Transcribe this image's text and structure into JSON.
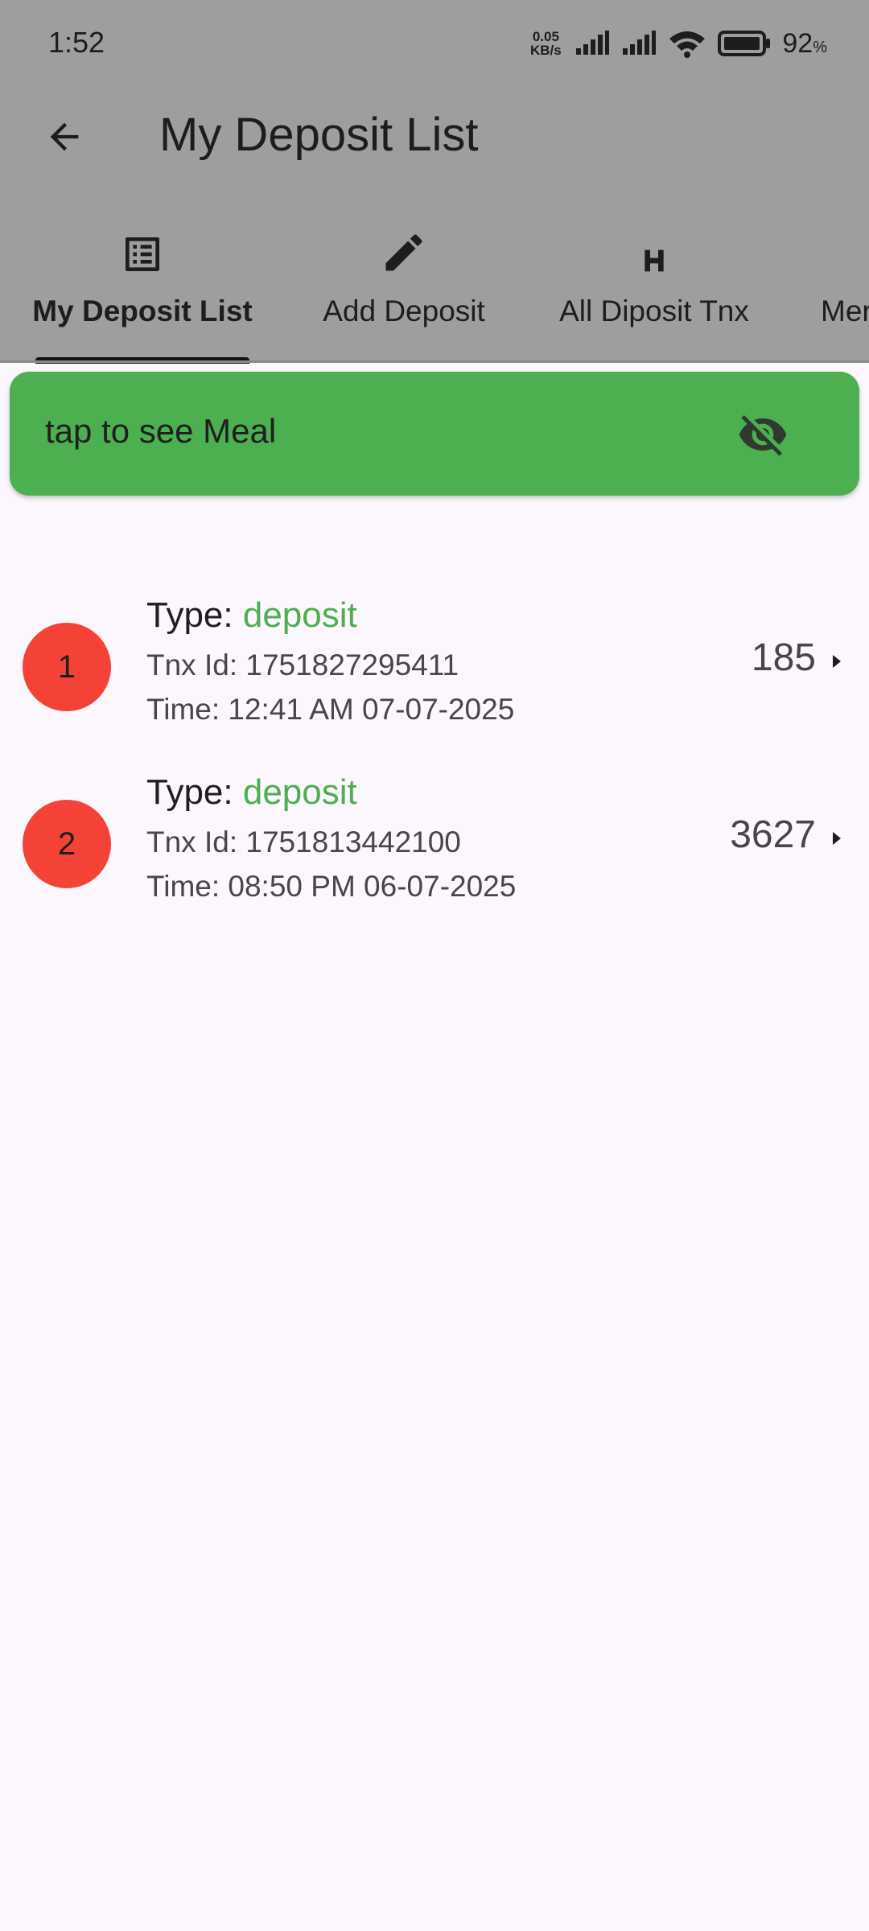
{
  "status_bar": {
    "time": "1:52",
    "net_speed_value": "0.05",
    "net_speed_unit": "KB/s",
    "battery_percent": "92",
    "battery_unit": "%"
  },
  "app_bar": {
    "title": "My Deposit List",
    "back_icon": "arrow-back-icon"
  },
  "tabs": [
    {
      "label": "My Deposit List",
      "icon": "list-icon",
      "active": true
    },
    {
      "label": "Add Deposit",
      "icon": "pencil-icon",
      "active": false
    },
    {
      "label": "All Diposit Tnx",
      "icon": "h-icon",
      "active": false
    },
    {
      "label": "Mer",
      "icon": "",
      "active": false
    }
  ],
  "meal_banner": {
    "text": "tap to see Meal",
    "icon": "eye-off-icon"
  },
  "deposits": [
    {
      "index": "1",
      "type_label": "Type: ",
      "type_value": "deposit",
      "tnx_id": "Tnx Id: 1751827295411",
      "time": "Time: 12:41 AM 07-07-2025",
      "amount": "185"
    },
    {
      "index": "2",
      "type_label": "Type: ",
      "type_value": "deposit",
      "tnx_id": "Tnx Id: 1751813442100",
      "time": "Time: 08:50 PM 06-07-2025",
      "amount": "3627"
    }
  ],
  "colors": {
    "header_bg": "#9e9e9e",
    "page_bg": "#fcf6fd",
    "banner_green": "#4caf50",
    "avatar_red": "#f44336",
    "type_green": "#4caf50"
  }
}
